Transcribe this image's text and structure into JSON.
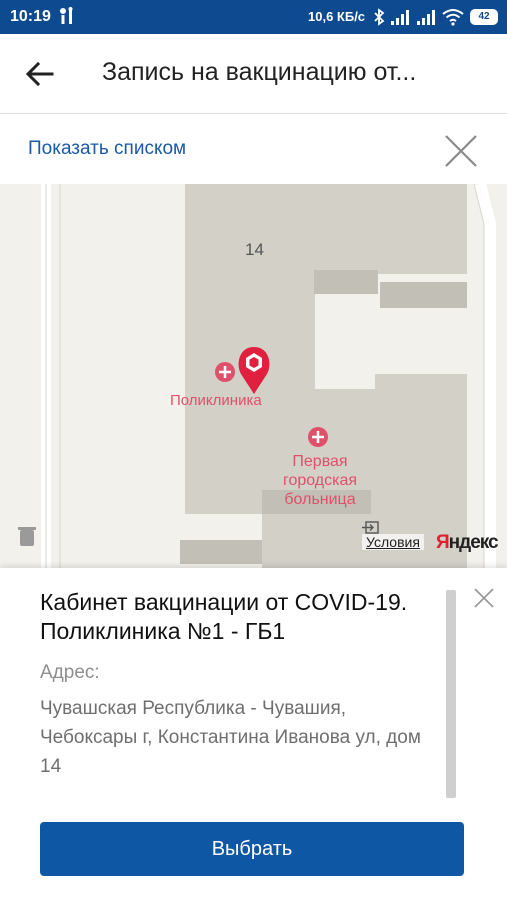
{
  "status_bar": {
    "time": "10:19",
    "network_speed": "10,6 КБ/с",
    "battery": "42",
    "background": "#0d4a8f"
  },
  "app_bar": {
    "title": "Запись на вакцинацию от..."
  },
  "list_toggle": {
    "label": "Показать списком"
  },
  "map": {
    "house_number": "14",
    "poi_polyclinic": "Поликлиника",
    "poi_hospital": "Первая городская больница",
    "terms_link": "Условия",
    "provider_logo_first": "Я",
    "provider_logo_rest": "ндекс",
    "poi_color": "#e0506a"
  },
  "place_card": {
    "title": "Кабинет вакцинации от COVID-19. Поликлиника №1 - ГБ1",
    "address_label": "Адрес:",
    "address": "Чувашская Республика - Чувашия, Чебоксары г, Константина Иванова ул, дом 14",
    "select_button": "Выбрать",
    "accent": "#0e57a4"
  }
}
